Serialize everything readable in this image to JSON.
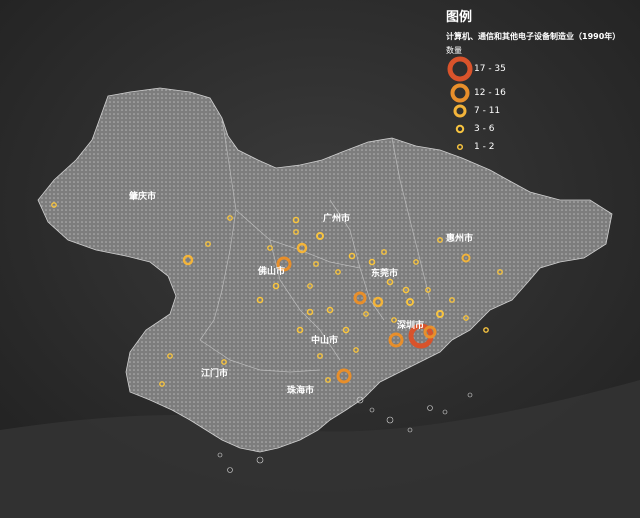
{
  "legend": {
    "title": "图例",
    "subtitle": "计算机、通信和其他电子设备制造业（1990年）",
    "quantity_label": "数量",
    "classes": [
      {
        "label": "17 - 35",
        "color": "#d9532b"
      },
      {
        "label": "12 - 16",
        "color": "#e88f2b"
      },
      {
        "label": "7 - 11",
        "color": "#f3b43a"
      },
      {
        "label": "3 - 6",
        "color": "#f7c440"
      },
      {
        "label": "1 - 2",
        "color": "#f7c440"
      }
    ]
  },
  "cities": [
    {
      "name": "肇庆市"
    },
    {
      "name": "广州市"
    },
    {
      "name": "佛山市"
    },
    {
      "name": "东莞市"
    },
    {
      "name": "惠州市"
    },
    {
      "name": "中山市"
    },
    {
      "name": "深圳市"
    },
    {
      "name": "江门市"
    },
    {
      "name": "珠海市"
    }
  ],
  "colors": {
    "land": "#8a8a8a",
    "background": "#2a2a2a",
    "sea": "#3a3a3a"
  }
}
